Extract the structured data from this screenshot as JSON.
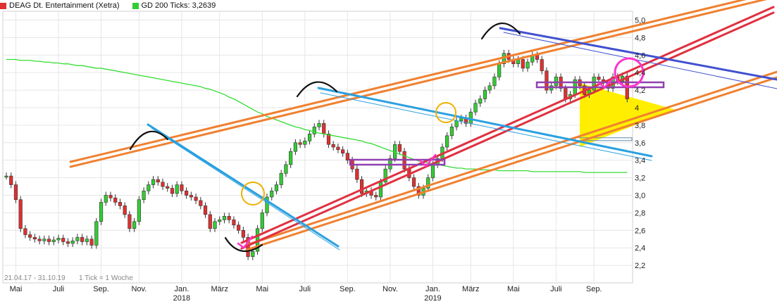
{
  "legend": [
    {
      "label": "DEAG Dt. Entertainment (Xetra)",
      "color": "#e03030"
    },
    {
      "label": "GD 200 Ticks: 3,2639",
      "color": "#33cc33"
    }
  ],
  "footer": {
    "range": "21.04.17 - 31.10.19",
    "tick": "1 Tick = 1 Woche"
  },
  "chart_data": {
    "type": "candlestick",
    "y_range": [
      2.0,
      5.1
    ],
    "y_ticks": [
      "5,0",
      "4,8",
      "4,6",
      "4,4",
      "4,2",
      "4",
      "3,8",
      "3,6",
      "3,4",
      "3,2",
      "3,0",
      "2,8",
      "2,6",
      "2,4",
      "2,2"
    ],
    "y_tick_values": [
      5.0,
      4.8,
      4.6,
      4.4,
      4.2,
      4.0,
      3.8,
      3.6,
      3.4,
      3.2,
      3.0,
      2.8,
      2.6,
      2.4,
      2.2
    ],
    "x_ticks": [
      {
        "label": "Mai",
        "week": 2
      },
      {
        "label": "Juli",
        "week": 11
      },
      {
        "label": "Sep.",
        "week": 20
      },
      {
        "label": "Nov.",
        "week": 28
      },
      {
        "label": "Jan.",
        "year": "2018",
        "week": 37
      },
      {
        "label": "März",
        "week": 45
      },
      {
        "label": "Mai",
        "week": 54
      },
      {
        "label": "Juli",
        "week": 63
      },
      {
        "label": "Sep.",
        "week": 72
      },
      {
        "label": "Nov.",
        "week": 81
      },
      {
        "label": "Jan.",
        "year": "2019",
        "week": 90
      },
      {
        "label": "März",
        "week": 98
      },
      {
        "label": "Mai",
        "week": 107
      },
      {
        "label": "Juli",
        "week": 116
      },
      {
        "label": "Sep.",
        "week": 124
      }
    ],
    "weeks_total": 132,
    "close": [
      3.22,
      3.12,
      2.95,
      2.62,
      2.55,
      2.52,
      2.5,
      2.48,
      2.5,
      2.47,
      2.49,
      2.51,
      2.47,
      2.45,
      2.48,
      2.52,
      2.47,
      2.5,
      2.43,
      2.7,
      2.92,
      3.0,
      2.97,
      2.92,
      2.88,
      2.78,
      2.62,
      2.7,
      2.95,
      3.05,
      3.12,
      3.18,
      3.15,
      3.1,
      3.08,
      3.02,
      3.12,
      3.05,
      3.0,
      2.98,
      2.94,
      2.88,
      2.78,
      2.62,
      2.7,
      2.72,
      2.76,
      2.72,
      2.66,
      2.6,
      2.52,
      2.3,
      2.36,
      2.62,
      2.8,
      2.98,
      3.05,
      3.12,
      3.25,
      3.35,
      3.5,
      3.6,
      3.58,
      3.62,
      3.7,
      3.78,
      3.82,
      3.7,
      3.58,
      3.55,
      3.52,
      3.48,
      3.4,
      3.3,
      3.18,
      3.02,
      3.05,
      3.0,
      2.98,
      3.15,
      3.3,
      3.42,
      3.58,
      3.5,
      3.3,
      3.2,
      3.1,
      3.0,
      3.08,
      3.2,
      3.35,
      3.42,
      3.55,
      3.68,
      3.78,
      3.85,
      3.88,
      3.82,
      3.95,
      4.05,
      4.1,
      4.2,
      4.25,
      4.35,
      4.5,
      4.62,
      4.55,
      4.5,
      4.55,
      4.45,
      4.52,
      4.6,
      4.55,
      4.42,
      4.2,
      4.25,
      4.35,
      4.22,
      4.1,
      4.15,
      4.32,
      4.25,
      4.15,
      4.2,
      4.35,
      4.32,
      4.28,
      4.22,
      4.35,
      4.3,
      4.36,
      4.1
    ],
    "ma200": [
      4.55,
      4.55,
      4.55,
      4.54,
      4.54,
      4.54,
      4.53,
      4.53,
      4.52,
      4.52,
      4.51,
      4.51,
      4.5,
      4.5,
      4.49,
      4.48,
      4.48,
      4.47,
      4.46,
      4.45,
      4.45,
      4.44,
      4.43,
      4.42,
      4.41,
      4.4,
      4.39,
      4.38,
      4.37,
      4.36,
      4.35,
      4.34,
      4.33,
      4.32,
      4.31,
      4.3,
      4.29,
      4.28,
      4.27,
      4.26,
      4.25,
      4.24,
      4.22,
      4.21,
      4.19,
      4.17,
      4.15,
      4.12,
      4.1,
      4.07,
      4.04,
      4.01,
      3.98,
      3.95,
      3.93,
      3.9,
      3.88,
      3.86,
      3.84,
      3.82,
      3.8,
      3.78,
      3.77,
      3.75,
      3.74,
      3.72,
      3.71,
      3.7,
      3.69,
      3.68,
      3.67,
      3.66,
      3.65,
      3.64,
      3.63,
      3.62,
      3.6,
      3.59,
      3.57,
      3.55,
      3.53,
      3.51,
      3.49,
      3.47,
      3.45,
      3.43,
      3.41,
      3.39,
      3.38,
      3.37,
      3.36,
      3.35,
      3.34,
      3.33,
      3.32,
      3.31,
      3.31,
      3.3,
      3.3,
      3.3,
      3.29,
      3.29,
      3.29,
      3.29,
      3.28,
      3.28,
      3.28,
      3.28,
      3.28,
      3.28,
      3.28,
      3.27,
      3.27,
      3.27,
      3.27,
      3.27,
      3.27,
      3.27,
      3.27,
      3.27,
      3.27,
      3.27,
      3.26,
      3.26,
      3.26,
      3.26,
      3.26,
      3.26,
      3.26,
      3.26,
      3.26,
      3.26
    ]
  }
}
